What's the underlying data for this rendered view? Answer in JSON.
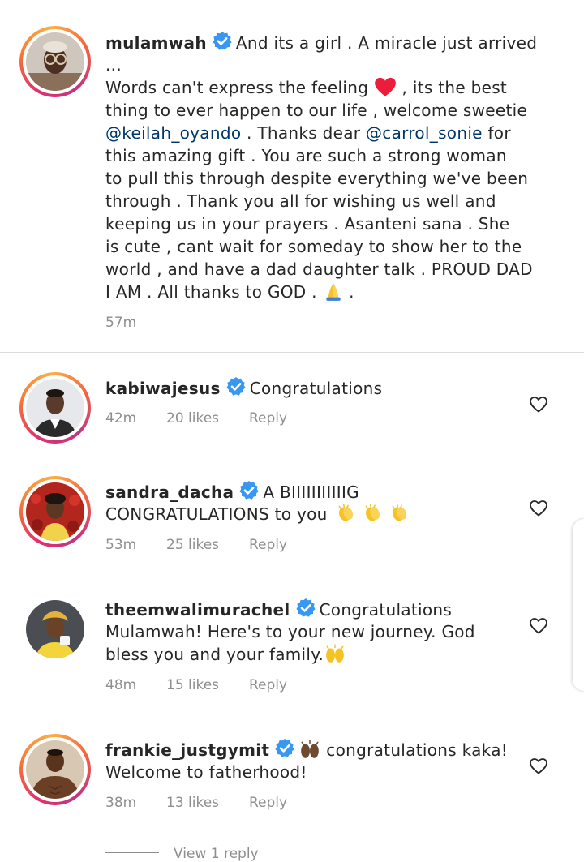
{
  "caption": {
    "username": "mulamwah",
    "lines": [
      "And its a girl . A miracle just arrived",
      "...",
      "Words can't express the feeling",
      ", its the best",
      "thing to ever happen to our life , welcome sweetie",
      "@keilah_oyando",
      ". Thanks dear",
      "@carrol_sonie",
      "for",
      "this amazing gift . You are such a strong woman",
      "to pull this through despite everything we've been",
      "through . Thank you all for wishing us well and",
      "keeping us in your prayers . Asanteni sana . She",
      "is cute , cant wait for someday to show her to the",
      "world , and have a dad daughter talk . PROUD DAD",
      "I AM . All thanks to GOD .",
      "."
    ],
    "time": "57m"
  },
  "comments": [
    {
      "username": "kabiwajesus",
      "text_lines": [
        "Congratulations"
      ],
      "time": "42m",
      "likes": "20 likes",
      "reply": "Reply"
    },
    {
      "username": "sandra_dacha",
      "text_lines": [
        "A BIIIIIIIIIIIG",
        "CONGRATULATIONS to you"
      ],
      "time": "53m",
      "likes": "25 likes",
      "reply": "Reply"
    },
    {
      "username": "theemwalimurachel",
      "text_lines": [
        "Congratulations",
        "Mulamwah! Here's to your new journey. God",
        "bless you and your family."
      ],
      "time": "48m",
      "likes": "15 likes",
      "reply": "Reply"
    },
    {
      "username": "frankie_justgymit",
      "text_lines": [
        "congratulations kaka!",
        "Welcome to fatherhood!"
      ],
      "time": "38m",
      "likes": "13 likes",
      "reply": "Reply"
    }
  ],
  "view_replies": "View 1 reply",
  "colors": {
    "verified": "#3897f0",
    "mention": "#00376b",
    "meta": "#8e8e8e",
    "heart_red": "#ed1c3b"
  },
  "icons": [
    "verified-badge-icon",
    "heart-outline-icon",
    "red-heart-emoji",
    "praying-hands-emoji",
    "clapping-hands-emoji",
    "raising-hands-emoji"
  ]
}
